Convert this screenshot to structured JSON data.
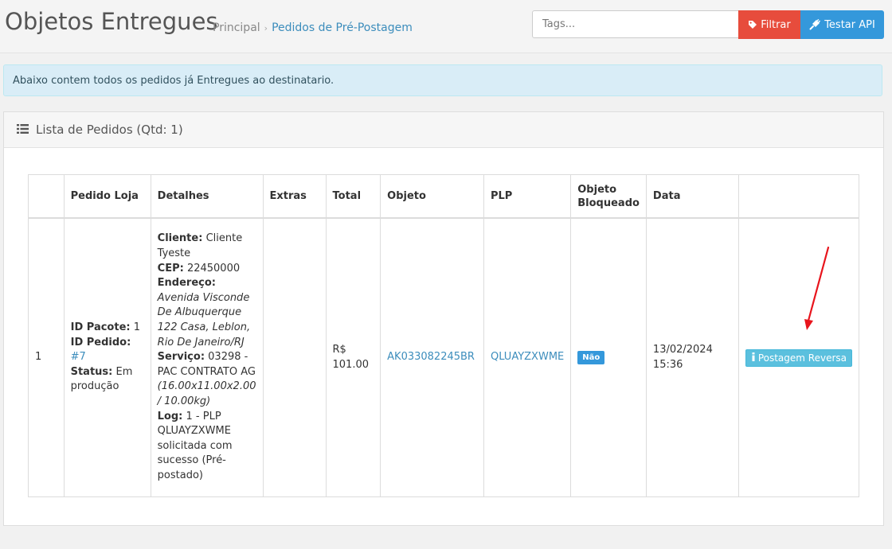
{
  "header": {
    "title": "Objetos Entregues",
    "breadcrumb": {
      "home": "Principal",
      "separator": "›",
      "current": "Pedidos de Pré-Postagem"
    },
    "search": {
      "placeholder": "Tags...",
      "value": ""
    },
    "filter_label": "Filtrar",
    "api_label": "Testar API",
    "filter_icon": "tag-icon",
    "api_icon": "plug-icon"
  },
  "alert": {
    "text": "Abaixo contem todos os pedidos já Entregues ao destinatario."
  },
  "panel": {
    "title": "Lista de Pedidos (Qtd: 1)",
    "icon": "list-icon"
  },
  "table": {
    "columns": [
      "",
      "Pedido Loja",
      "Detalhes",
      "Extras",
      "Total",
      "Objeto",
      "PLP",
      "Objeto Bloqueado",
      "Data",
      ""
    ],
    "rows": [
      {
        "index": "1",
        "pedido": {
          "id_pacote_label": "ID Pacote:",
          "id_pacote": "1",
          "id_pedido_label": "ID Pedido:",
          "id_pedido": "#7",
          "status_label": "Status:",
          "status": "Em produção"
        },
        "detalhes": {
          "cliente_label": "Cliente:",
          "cliente": "Cliente Tyeste",
          "cep_label": "CEP:",
          "cep": "22450000",
          "endereco_label": "Endereço:",
          "endereco": "Avenida Visconde De Albuquerque 122 Casa, Leblon, Rio De Janeiro/RJ",
          "servico_label": "Serviço:",
          "servico": "03298 - PAC CONTRATO AG",
          "dimensoes": "(16.00x11.00x2.00 / 10.00kg)",
          "log_label": "Log:",
          "log": "1 - PLP QLUAYZXWME solicitada com sucesso (Pré-postado)"
        },
        "extras": "",
        "total": "R$ 101.00",
        "objeto": "AK033082245BR",
        "plp": "QLUAYZXWME",
        "bloqueado": "Não",
        "data": "13/02/2024 15:36",
        "action_label": "Postagem Reversa",
        "action_icon": "info-icon"
      }
    ]
  },
  "colors": {
    "filter_button": "#e74c3c",
    "api_button": "#3498db",
    "info_alert": "#d9edf7",
    "link": "#3c8dbc",
    "badge": "#3498db",
    "action_button": "#5bc0de",
    "annotation_arrow": "#e8141c"
  }
}
